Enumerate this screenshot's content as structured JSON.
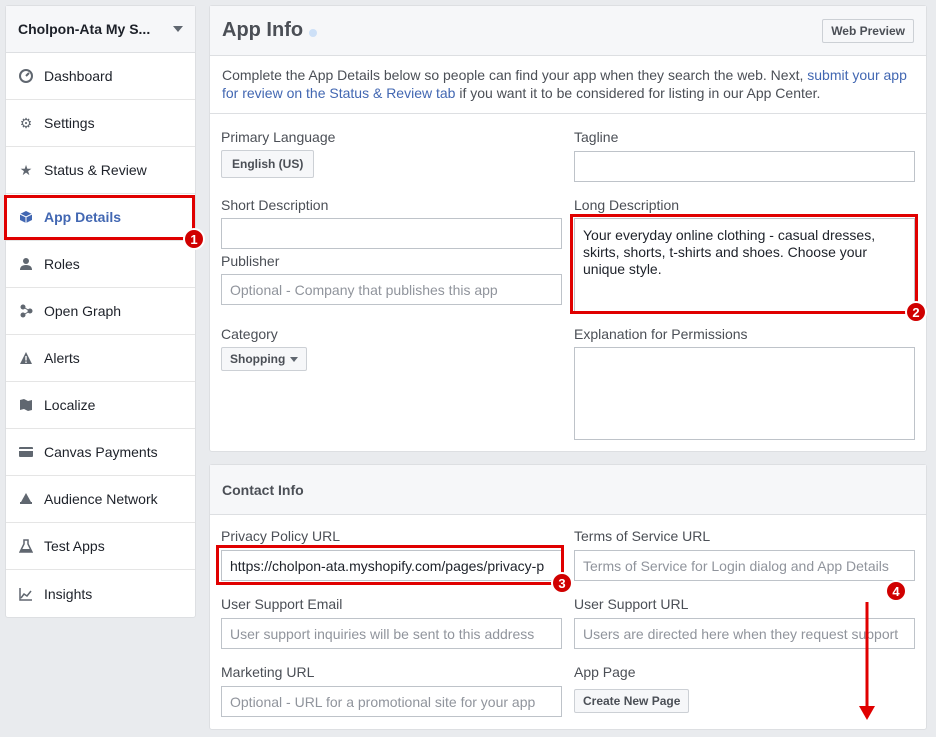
{
  "sidebar": {
    "app_name": "Cholpon-Ata My S...",
    "items": [
      {
        "label": "Dashboard",
        "icon": "dashboard-icon"
      },
      {
        "label": "Settings",
        "icon": "gear-icon"
      },
      {
        "label": "Status & Review",
        "icon": "star-icon"
      },
      {
        "label": "App Details",
        "icon": "cube-icon"
      },
      {
        "label": "Roles",
        "icon": "person-icon"
      },
      {
        "label": "Open Graph",
        "icon": "graph-icon"
      },
      {
        "label": "Alerts",
        "icon": "warning-icon"
      },
      {
        "label": "Localize",
        "icon": "flag-icon"
      },
      {
        "label": "Canvas Payments",
        "icon": "card-icon"
      },
      {
        "label": "Audience Network",
        "icon": "megaphone-icon"
      },
      {
        "label": "Test Apps",
        "icon": "flask-icon"
      },
      {
        "label": "Insights",
        "icon": "chart-icon"
      }
    ],
    "active": "App Details"
  },
  "app_info": {
    "title": "App Info",
    "web_preview": "Web Preview",
    "intro_pre": "Complete the App Details below so people can find your app when they search the web. Next, ",
    "intro_link": "submit your app for review on the Status & Review tab",
    "intro_post": " if you want it to be considered for listing in our App Center.",
    "primary_language_label": "Primary Language",
    "primary_language_value": "English (US)",
    "tagline_label": "Tagline",
    "tagline_value": "",
    "short_description_label": "Short Description",
    "short_description_value": "",
    "long_description_label": "Long Description",
    "long_description_value": "Your everyday online clothing - casual dresses, skirts, shorts, t-shirts and shoes. Choose your unique style.",
    "publisher_label": "Publisher",
    "publisher_placeholder": "Optional - Company that publishes this app",
    "category_label": "Category",
    "category_value": "Shopping",
    "explanation_label": "Explanation for Permissions",
    "explanation_value": ""
  },
  "contact_info": {
    "title": "Contact Info",
    "privacy_label": "Privacy Policy URL",
    "privacy_value": "https://cholpon-ata.myshopify.com/pages/privacy-p",
    "tos_label": "Terms of Service URL",
    "tos_placeholder": "Terms of Service for Login dialog and App Details",
    "support_email_label": "User Support Email",
    "support_email_placeholder": "User support inquiries will be sent to this address",
    "support_url_label": "User Support URL",
    "support_url_placeholder": "Users are directed here when they request support",
    "marketing_label": "Marketing URL",
    "marketing_placeholder": "Optional - URL for a promotional site for your app",
    "app_page_label": "App Page",
    "create_page_button": "Create New Page"
  },
  "annotations": {
    "b1": "1",
    "b2": "2",
    "b3": "3",
    "b4": "4",
    "color": "#e00000"
  }
}
